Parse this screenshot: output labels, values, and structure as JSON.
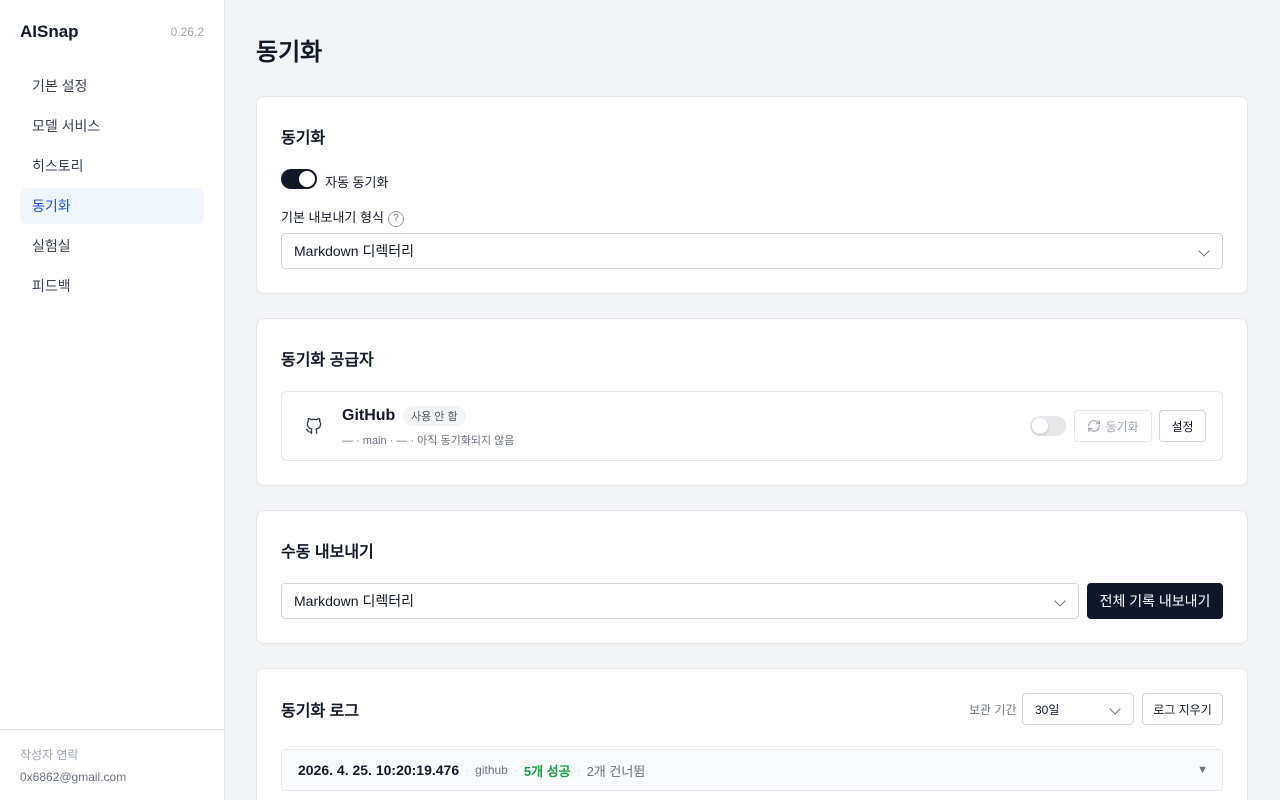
{
  "sidebar": {
    "brand": "AISnap",
    "version": "0.26.2",
    "items": [
      {
        "label": "기본 설정"
      },
      {
        "label": "모델 서비스"
      },
      {
        "label": "히스토리"
      },
      {
        "label": "동기화",
        "active": true
      },
      {
        "label": "실험실"
      },
      {
        "label": "피드백"
      }
    ],
    "footer": {
      "contact_label": "작성자 연락",
      "email": "0x6862@gmail.com"
    }
  },
  "page": {
    "title": "동기화"
  },
  "sync": {
    "title": "동기화",
    "auto_sync_label": "자동 동기화",
    "auto_sync_on": true,
    "format_label": "기본 내보내기 형식",
    "help_glyph": "?",
    "format_value": "Markdown 디렉터리"
  },
  "providers": {
    "title": "동기화 공급자",
    "github": {
      "name": "GitHub",
      "badge": "사용 안 함",
      "meta": "— · main · — · 아직 동기화되지 않음",
      "enabled": false,
      "sync_label": "동기화",
      "settings_label": "설정"
    }
  },
  "manual_export": {
    "title": "수동 내보내기",
    "format_value": "Markdown 디렉터리",
    "export_label": "전체 기록 내보내기"
  },
  "sync_log": {
    "title": "동기화 로그",
    "retention_label": "보관 기간",
    "retention_value": "30일",
    "clear_label": "로그 지우기",
    "entries": [
      {
        "time": "2026. 4. 25. 10:20:19.476",
        "provider": "github",
        "success": "5개 성공",
        "skipped": "2개 건너뜀"
      }
    ]
  },
  "colors": {
    "accent": "#1d4ed8",
    "accent_bg": "#eff6ff",
    "primary_button": "#0f172a",
    "success": "#16a34a"
  }
}
